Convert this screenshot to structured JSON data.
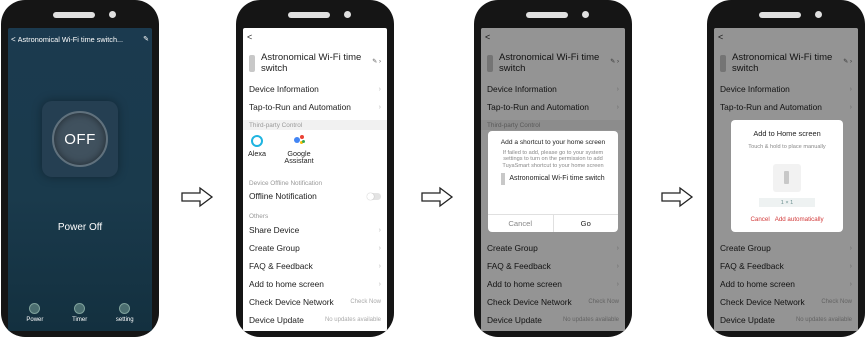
{
  "screen1": {
    "title": "Astronomical Wi-Fi time switch...",
    "state_label": "OFF",
    "power_text": "Power Off",
    "tabs": [
      {
        "label": "Power",
        "icon": "power-icon"
      },
      {
        "label": "Timer",
        "icon": "timer-icon"
      },
      {
        "label": "setting",
        "icon": "settings-icon"
      }
    ]
  },
  "settings": {
    "device_name": "Astronomical Wi-Fi time switch",
    "device_info": "Device Information",
    "tap_to_run": "Tap-to-Run and Automation",
    "third_party_section": "Third-party Control",
    "alexa": "Alexa",
    "google_assistant": "Google Assistant",
    "offline_section": "Device Offline Notification",
    "offline_notification": "Offline Notification",
    "others_section": "Others",
    "share_device": "Share Device",
    "create_group": "Create Group",
    "faq": "FAQ & Feedback",
    "add_home_screen": "Add to home screen",
    "check_network": "Check Device Network",
    "check_now": "Check Now",
    "device_update": "Device Update",
    "no_updates": "No updates available"
  },
  "dialog_shortcut": {
    "title": "Add a shortcut to your home screen",
    "description": "If failed to add, please go to your system settings to turn on the permission to add TuyaSmart shortcut to your home screen",
    "device_name": "Astronomical Wi-Fi time switch",
    "cancel": "Cancel",
    "go": "Go"
  },
  "dialog_home": {
    "title": "Add to Home screen",
    "hint": "Touch & hold to place manually",
    "size": "1 × 1",
    "cancel": "Cancel",
    "add_auto": "Add automatically"
  },
  "colors": {
    "screen1_bg": "#1a3a4c",
    "accent_red": "#d23a3a",
    "alexa_blue": "#1fb4e0"
  }
}
